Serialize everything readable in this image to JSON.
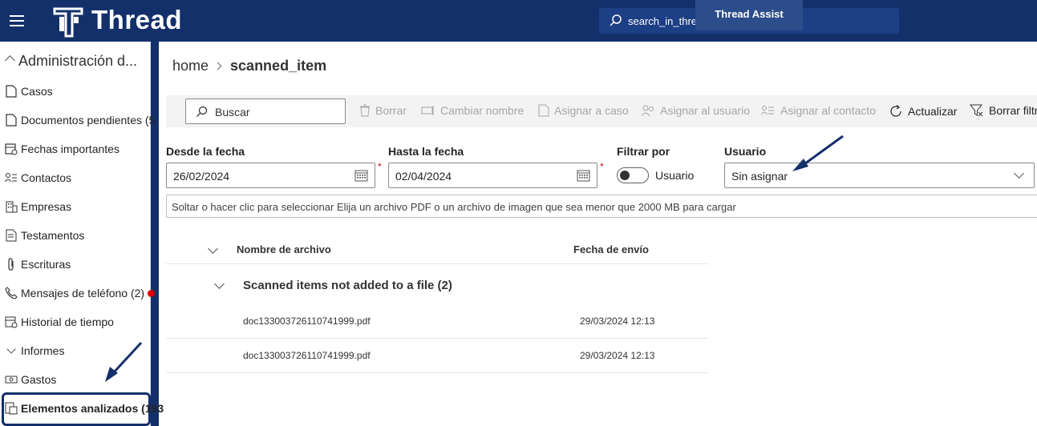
{
  "header": {
    "app_name": "Thread",
    "search_text": "search_in_thre",
    "assist_label": "Thread Assist"
  },
  "sidebar": {
    "section_title": "Administración d...",
    "items": [
      {
        "label": "Casos",
        "icon": "document-icon"
      },
      {
        "label": "Documentos pendientes (5",
        "icon": "document-icon"
      },
      {
        "label": "Fechas importantes",
        "icon": "calendar-icon"
      },
      {
        "label": "Contactos",
        "icon": "contacts-icon"
      },
      {
        "label": "Empresas",
        "icon": "building-icon"
      },
      {
        "label": "Testamentos",
        "icon": "will-icon"
      },
      {
        "label": "Escrituras",
        "icon": "paperclip-icon"
      },
      {
        "label": "Mensajes de teléfono (2)",
        "icon": "phone-icon"
      },
      {
        "label": "Historial de tiempo",
        "icon": "calendar-clock-icon"
      },
      {
        "label": "Informes",
        "icon": "chevron-down-icon"
      },
      {
        "label": "Gastos",
        "icon": "money-icon"
      },
      {
        "label": "Elementos analizados (193",
        "icon": "scan-icon"
      }
    ]
  },
  "breadcrumb": {
    "home": "home",
    "current": "scanned_item"
  },
  "toolbar": {
    "search_placeholder": "Buscar",
    "delete": "Borrar",
    "rename": "Cambiar nombre",
    "assign_case": "Asignar a caso",
    "assign_user": "Asignar al usuario",
    "assign_contact": "Asignar al contacto",
    "refresh": "Actualizar",
    "clear_filters": "Borrar filtr"
  },
  "filters": {
    "from_label": "Desde la fecha",
    "from_value": "26/02/2024",
    "to_label": "Hasta la fecha",
    "to_value": "02/04/2024",
    "filter_by_label": "Filtrar por",
    "toggle_label": "Usuario",
    "user_label": "Usuario",
    "user_value": "Sin asignar",
    "required_mark": "*"
  },
  "dropzone": {
    "text": "Soltar o hacer clic para seleccionar Elija un archivo PDF o un archivo de imagen que sea menor que 2000 MB para cargar"
  },
  "grid": {
    "col_name": "Nombre de archivo",
    "col_date": "Fecha de envío",
    "group_title": "Scanned items not added to a file (2)",
    "rows": [
      {
        "name": "doc133003726110741999.pdf",
        "date": "29/03/2024 12:13"
      },
      {
        "name": "doc133003726110741999.pdf",
        "date": "29/03/2024 12:13"
      }
    ]
  },
  "colors": {
    "brand": "#13306b",
    "accent_red": "#d90000"
  }
}
